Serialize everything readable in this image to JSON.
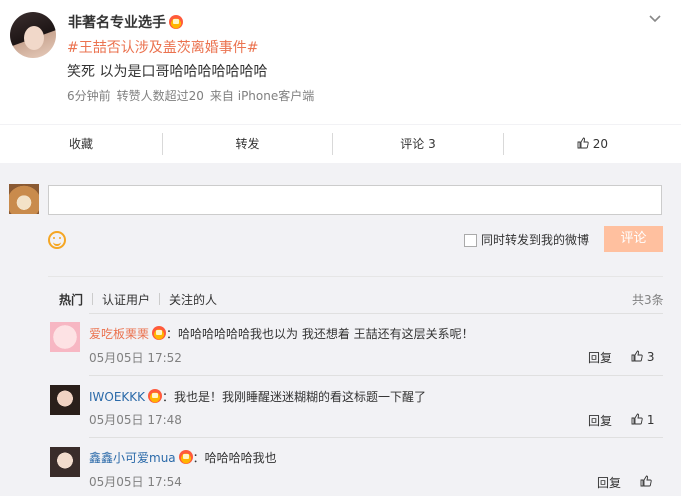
{
  "post": {
    "username": "非著名专业选手",
    "topic_prefix": "#",
    "topic_name": "王喆",
    "topic_rest": "否认涉及盖茨离婚事件#",
    "content": "笑死 以为是口哥哈哈哈哈哈哈哈",
    "time": "6分钟前",
    "reposts": "转赞人数超过20",
    "source": "来自 iPhone客户端"
  },
  "actions": {
    "favorite": "收藏",
    "repost": "转发",
    "comment": "评论 3",
    "like_count": "20"
  },
  "compose": {
    "placeholder": "",
    "repost_label": "同时转发到我的微博",
    "submit": "评论"
  },
  "comments_header": {
    "tabs": [
      "热门",
      "认证用户",
      "关注的人"
    ],
    "total": "共3条"
  },
  "comments": [
    {
      "name": "爱吃板栗栗",
      "text": "：哈哈哈哈哈哈我也以为 我还想着 王喆还有这层关系呢！",
      "time": "05月05日 17:52",
      "reply": "回复",
      "likes": "3"
    },
    {
      "name": "IWOEKKK",
      "text": "：我也是！我刚睡醒迷迷糊糊的看这标题一下醒了",
      "time": "05月05日 17:48",
      "reply": "回复",
      "likes": "1"
    },
    {
      "name": "鑫鑫小可爱mua",
      "text": "：哈哈哈哈我也",
      "time": "05月05日 17:54",
      "reply": "回复",
      "likes": ""
    }
  ],
  "colors": {
    "accent": "#eb7350",
    "submit_disabled": "#ffc09f",
    "panel_bg": "#f2f2f5"
  }
}
